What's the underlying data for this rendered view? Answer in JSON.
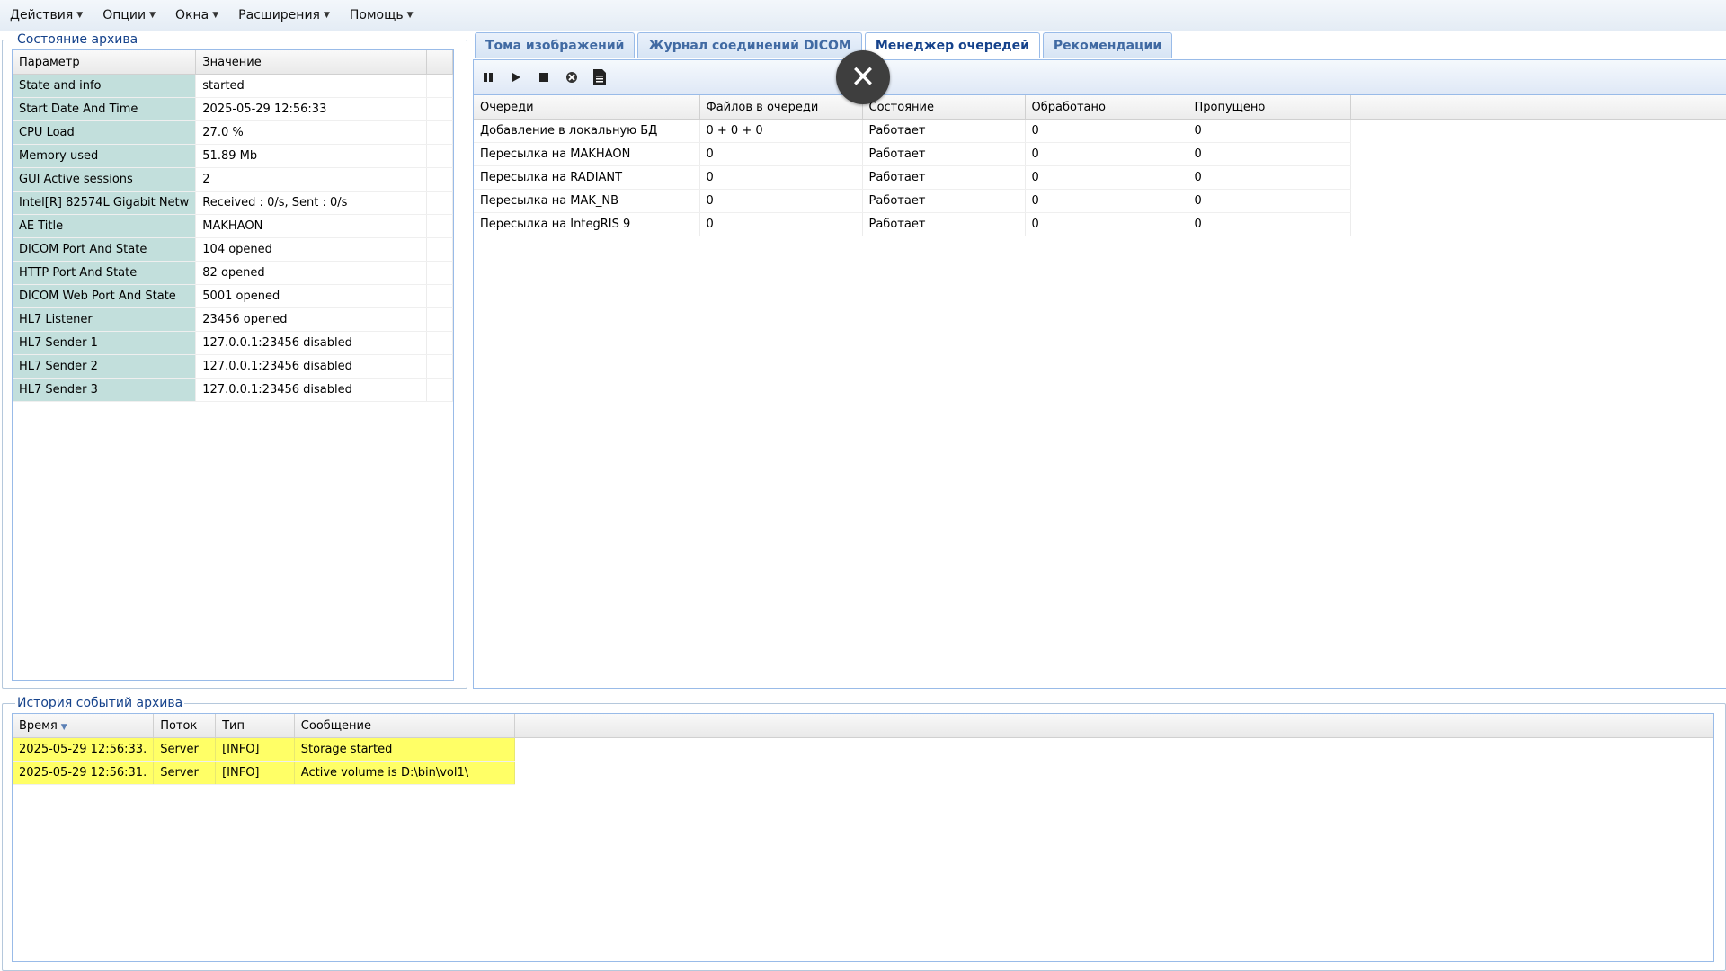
{
  "menu": [
    {
      "label": "Действия"
    },
    {
      "label": "Опции"
    },
    {
      "label": "Окна"
    },
    {
      "label": "Расширения"
    },
    {
      "label": "Помощь"
    }
  ],
  "status_panel": {
    "legend": "Состояние архива",
    "headers": [
      "Параметр",
      "Значение"
    ],
    "rows": [
      {
        "k": "State and info",
        "v": "started"
      },
      {
        "k": "Start Date And Time",
        "v": "2025-05-29 12:56:33"
      },
      {
        "k": "CPU Load",
        "v": "27.0 %"
      },
      {
        "k": "Memory used",
        "v": "51.89 Mb"
      },
      {
        "k": "GUI Active sessions",
        "v": "2"
      },
      {
        "k": "Intel[R] 82574L Gigabit Netw",
        "v": "Received : 0/s, Sent : 0/s"
      },
      {
        "k": "AE Title",
        "v": "MAKHAON"
      },
      {
        "k": "DICOM Port And State",
        "v": "104 opened"
      },
      {
        "k": "HTTP Port And State",
        "v": "82 opened"
      },
      {
        "k": "DICOM Web Port And State",
        "v": "5001 opened"
      },
      {
        "k": "HL7 Listener",
        "v": "23456 opened"
      },
      {
        "k": "HL7 Sender 1",
        "v": "127.0.0.1:23456 disabled"
      },
      {
        "k": "HL7 Sender 2",
        "v": "127.0.0.1:23456 disabled"
      },
      {
        "k": "HL7 Sender 3",
        "v": "127.0.0.1:23456 disabled"
      }
    ]
  },
  "tabs": [
    {
      "label": "Тома изображений",
      "active": false
    },
    {
      "label": "Журнал соединений DICOM",
      "active": false
    },
    {
      "label": "Менеджер очередей",
      "active": true
    },
    {
      "label": "Рекомендации",
      "active": false
    }
  ],
  "queue": {
    "headers": [
      "Очереди",
      "Файлов в очереди",
      "Состояние",
      "Обработано",
      "Пропущено"
    ],
    "rows": [
      [
        "Добавление в локальную БД",
        "0 + 0 + 0",
        "Работает",
        "0",
        "0"
      ],
      [
        "Пересылка на MAKHAON",
        "0",
        "Работает",
        "0",
        "0"
      ],
      [
        "Пересылка на RADIANT",
        "0",
        "Работает",
        "0",
        "0"
      ],
      [
        "Пересылка на MAK_NB",
        "0",
        "Работает",
        "0",
        "0"
      ],
      [
        "Пересылка на IntegRIS 9",
        "0",
        "Работает",
        "0",
        "0"
      ]
    ]
  },
  "toolbar_icons": [
    "pause-icon",
    "play-icon",
    "stop-icon",
    "clear-icon",
    "document-icon"
  ],
  "close_glyph": "✕",
  "log_panel": {
    "legend": "История событий архива",
    "headers": [
      "Время",
      "Поток",
      "Тип",
      "Сообщение"
    ],
    "rows": [
      [
        "2025-05-29 12:56:33.",
        "Server",
        "[INFO]",
        "Storage started"
      ],
      [
        "2025-05-29 12:56:31.",
        "Server",
        "[INFO]",
        "Active volume is D:\\bin\\vol1\\"
      ]
    ]
  }
}
